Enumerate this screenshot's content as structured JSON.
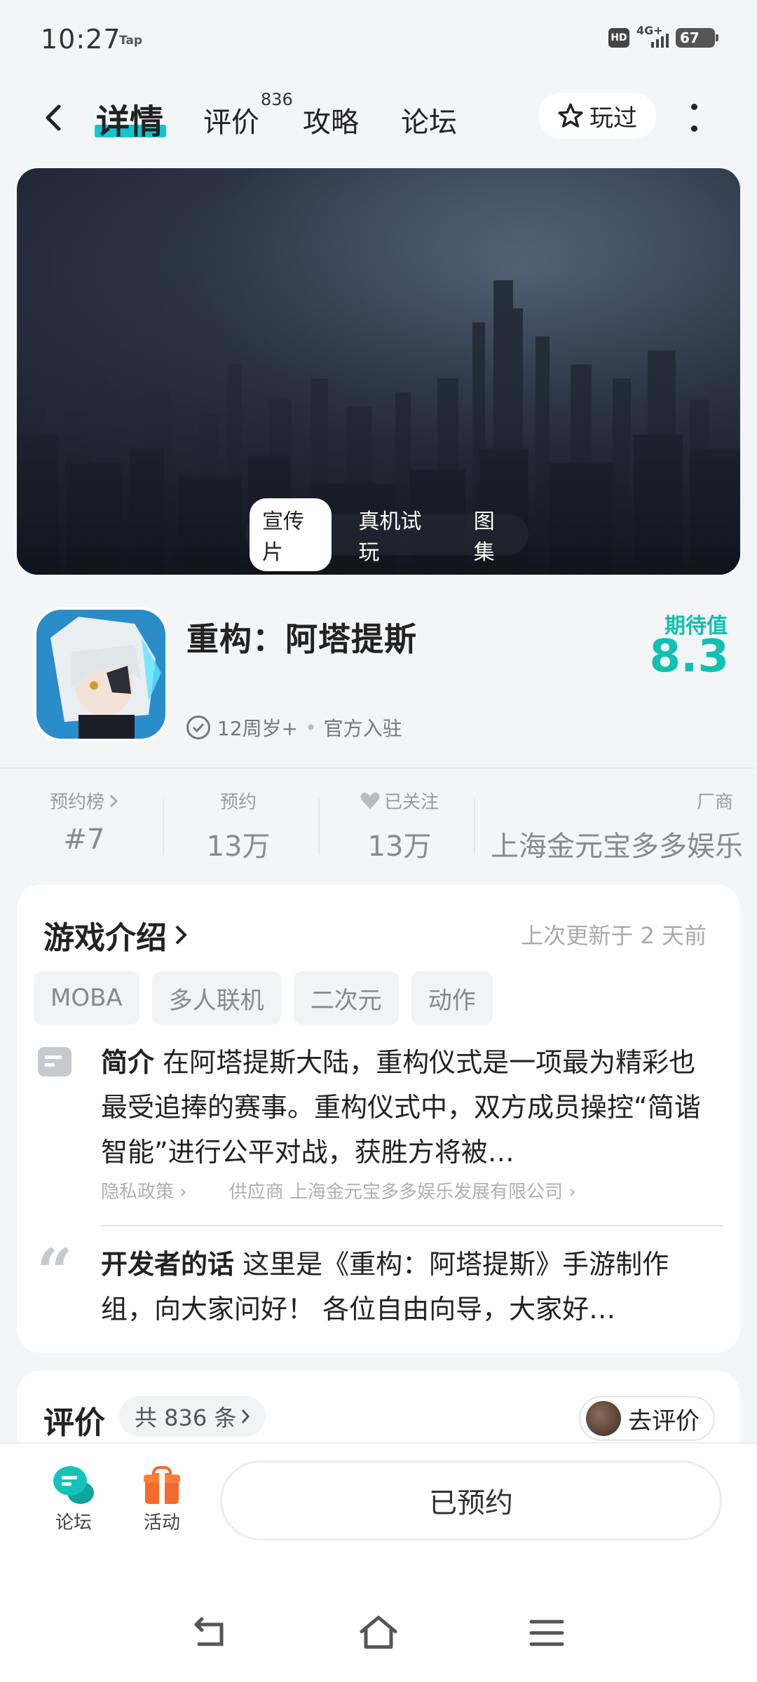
{
  "status_bar": {
    "time": "10:27",
    "carrier_tag": "Tap",
    "hd_label": "HD",
    "network": "4G+",
    "battery": "67"
  },
  "nav": {
    "tabs": [
      {
        "label": "详情",
        "active": true
      },
      {
        "label": "评价",
        "count": "836"
      },
      {
        "label": "攻略"
      },
      {
        "label": "论坛"
      }
    ],
    "played_label": "玩过",
    "accent_color": "#15c5ce"
  },
  "banner": {
    "tabs": [
      "宣传片",
      "真机试玩",
      "图集"
    ],
    "active_tab": "宣传片"
  },
  "game": {
    "title": "重构：阿塔提斯",
    "age": "12周岁+",
    "official": "官方入驻",
    "rating_label": "期待值",
    "rating_value": "8.3",
    "rating_color": "#10c0b0"
  },
  "stats": [
    {
      "label": "预约榜",
      "value": "#7",
      "icon": "chevron-right-icon"
    },
    {
      "label": "预约",
      "value": "13万"
    },
    {
      "label": "已关注",
      "value": "13万",
      "icon": "heart-icon"
    },
    {
      "label": "厂商",
      "value": "上海金元宝多多娱乐"
    }
  ],
  "intro": {
    "title": "游戏介绍",
    "updated": "上次更新于 2 天前",
    "tags": [
      "MOBA",
      "多人联机",
      "二次元",
      "动作"
    ],
    "desc_label": "简介",
    "desc_text": "在阿塔提斯大陆，重构仪式是一项最为精彩也最受追捧的赛事。重构仪式中，双方成员操控“简谐智能”进行公平对战，获胜方将被…",
    "privacy_label": "隐私政策",
    "supplier_label": "供应商 上海金元宝多多娱乐发展有限公司",
    "dev_label": "开发者的话",
    "dev_text": "这里是《重构：阿塔提斯》手游制作组，向大家问好！ 各位自由向导，大家好…"
  },
  "reviews": {
    "title": "评价",
    "count_label": "共 836 条",
    "go_review_label": "去评价"
  },
  "bottom_bar": {
    "forum_label": "论坛",
    "activity_label": "活动",
    "reserve_label": "已预约"
  }
}
